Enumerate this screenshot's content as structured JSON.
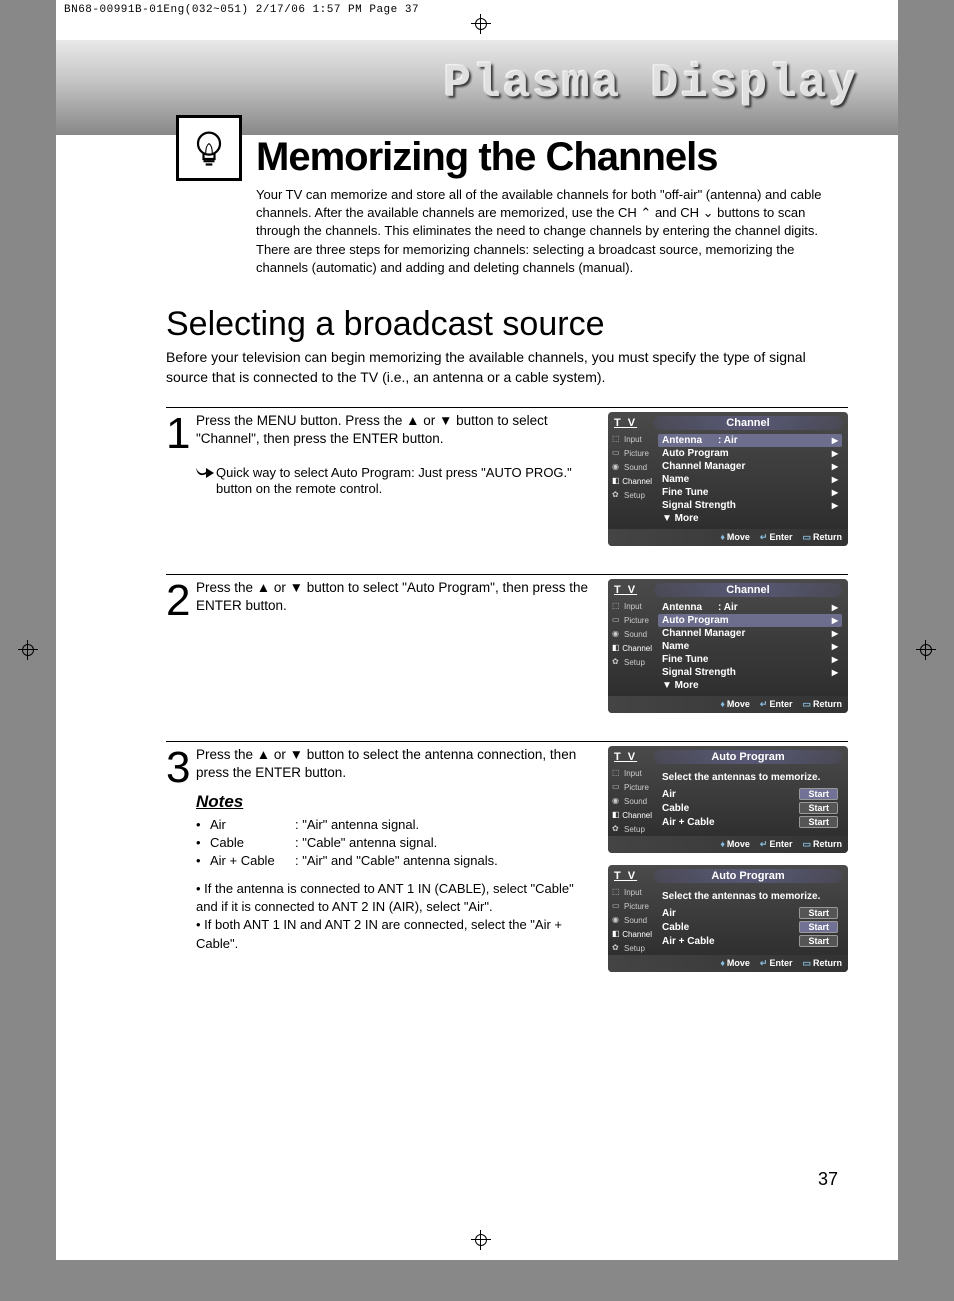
{
  "prepress": "BN68-00991B-01Eng(032~051)  2/17/06  1:57 PM  Page 37",
  "banner_title": "Plasma Display",
  "page_title": "Memorizing the Channels",
  "intro": "Your TV can memorize and store all of the available channels for both \"off-air\" (antenna) and cable channels. After the available channels are memorized, use the CH ⌃ and CH ⌄ buttons to scan through the channels. This eliminates the need to change channels by entering the channel digits. There are three steps for memorizing channels: selecting a broadcast source, memorizing the channels (automatic) and adding and deleting channels (manual).",
  "subtitle": "Selecting a broadcast source",
  "subintro": "Before your television can begin memorizing the available channels, you must specify the type of signal source that is connected to the TV (i.e., an antenna or a cable system).",
  "steps": {
    "s1": {
      "num": "1",
      "text": "Press the MENU button. Press the ▲ or ▼ button to select \"Channel\", then press the ENTER button.",
      "quick": "Quick way to select Auto Program: Just press \"AUTO PROG.\" button on the remote control."
    },
    "s2": {
      "num": "2",
      "text": "Press the ▲ or ▼ button to select \"Auto Program\", then press the ENTER button."
    },
    "s3": {
      "num": "3",
      "text": "Press the ▲ or ▼ button to select the antenna connection, then press the ENTER button.",
      "notes_hd": "Notes",
      "notes": {
        "n1": {
          "bul": "•",
          "lbl": "Air",
          "val": ": \"Air\" antenna signal."
        },
        "n2": {
          "bul": "•",
          "lbl": "Cable",
          "val": ": \"Cable\" antenna signal."
        },
        "n3": {
          "bul": "•",
          "lbl": "Air + Cable",
          "val": ": \"Air\" and \"Cable\" antenna signals."
        }
      },
      "extra1": "• If the antenna is connected to ANT 1 IN (CABLE), select \"Cable\" and if it is connected to ANT 2 IN (AIR), select \"Air\".",
      "extra2": "• If both ANT 1 IN and ANT 2 IN are connected, select the \"Air + Cable\"."
    }
  },
  "osd_common": {
    "tv": "T V",
    "side": [
      "Input",
      "Picture",
      "Sound",
      "Channel",
      "Setup"
    ],
    "foot_move": "Move",
    "foot_enter": "Enter",
    "foot_return": "Return"
  },
  "osd1": {
    "title": "Channel",
    "lines": [
      {
        "label": "Antenna",
        "val": ": Air",
        "hl": true
      },
      {
        "label": "Auto Program",
        "val": ""
      },
      {
        "label": "Channel Manager",
        "val": ""
      },
      {
        "label": "Name",
        "val": ""
      },
      {
        "label": "Fine Tune",
        "val": ""
      },
      {
        "label": "Signal Strength",
        "val": ""
      },
      {
        "label": "▼ More",
        "val": "",
        "noarrow": true
      }
    ]
  },
  "osd2": {
    "title": "Channel",
    "lines": [
      {
        "label": "Antenna",
        "val": ": Air"
      },
      {
        "label": "Auto Program",
        "val": "",
        "hl": true
      },
      {
        "label": "Channel Manager",
        "val": ""
      },
      {
        "label": "Name",
        "val": ""
      },
      {
        "label": "Fine Tune",
        "val": ""
      },
      {
        "label": "Signal Strength",
        "val": ""
      },
      {
        "label": "▼ More",
        "val": "",
        "noarrow": true
      }
    ]
  },
  "osd3": {
    "title": "Auto Program",
    "prompt": "Select the antennas to memorize.",
    "opts": [
      {
        "label": "Air",
        "btn": "Start",
        "hl": true
      },
      {
        "label": "Cable",
        "btn": "Start"
      },
      {
        "label": "Air + Cable",
        "btn": "Start"
      }
    ]
  },
  "osd4": {
    "title": "Auto Program",
    "prompt": "Select the antennas to memorize.",
    "opts": [
      {
        "label": "Air",
        "btn": "Start"
      },
      {
        "label": "Cable",
        "btn": "Start",
        "hl": true
      },
      {
        "label": "Air + Cable",
        "btn": "Start"
      }
    ]
  },
  "page_number": "37"
}
